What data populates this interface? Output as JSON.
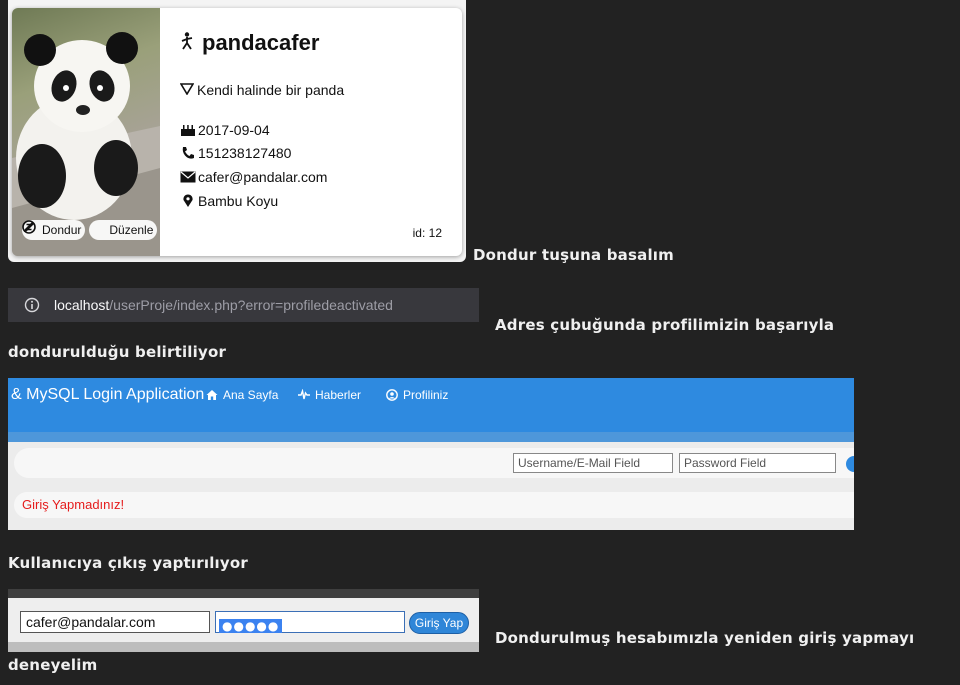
{
  "profile": {
    "username": "pandacafer",
    "bio": "Kendi halinde bir panda",
    "birthdate": "2017-09-04",
    "phone": "151238127480",
    "email": "cafer@pandalar.com",
    "location": "Bambu Koyu",
    "id_label": "id: 12",
    "freeze_button": "Dondur",
    "edit_button": "Düzenle"
  },
  "captions": {
    "step1": "Dondur tuşuna basalım",
    "step2_line1": "Adres çubuğunda profilimizin başarıyla",
    "step2_line2": "dondurulduğu belirtiliyor",
    "step3": "Kullanıcıya çıkış yaptırılıyor",
    "step4_line1": "Dondurulmuş hesabımızla yeniden giriş yapmayı",
    "step4_line2": "deneyelim"
  },
  "address_bar": {
    "host": "localhost",
    "path": "/userProje/index.php?error=profiledeactivated"
  },
  "app": {
    "brand": "& MySQL Login Application",
    "nav": [
      "Ana Sayfa",
      "Haberler",
      "Profiliniz"
    ],
    "username_placeholder": "Username/E-Mail Field",
    "password_placeholder": "Password Field",
    "error_message": "Giriş Yapmadınız!"
  },
  "login_form": {
    "email_value": "cafer@pandalar.com",
    "password_mask": "●●●●●",
    "submit_label": "Giriş Yap"
  },
  "colors": {
    "page_bg": "#222222",
    "nav_blue": "#2e8ae0",
    "error_red": "#e51c1c"
  }
}
